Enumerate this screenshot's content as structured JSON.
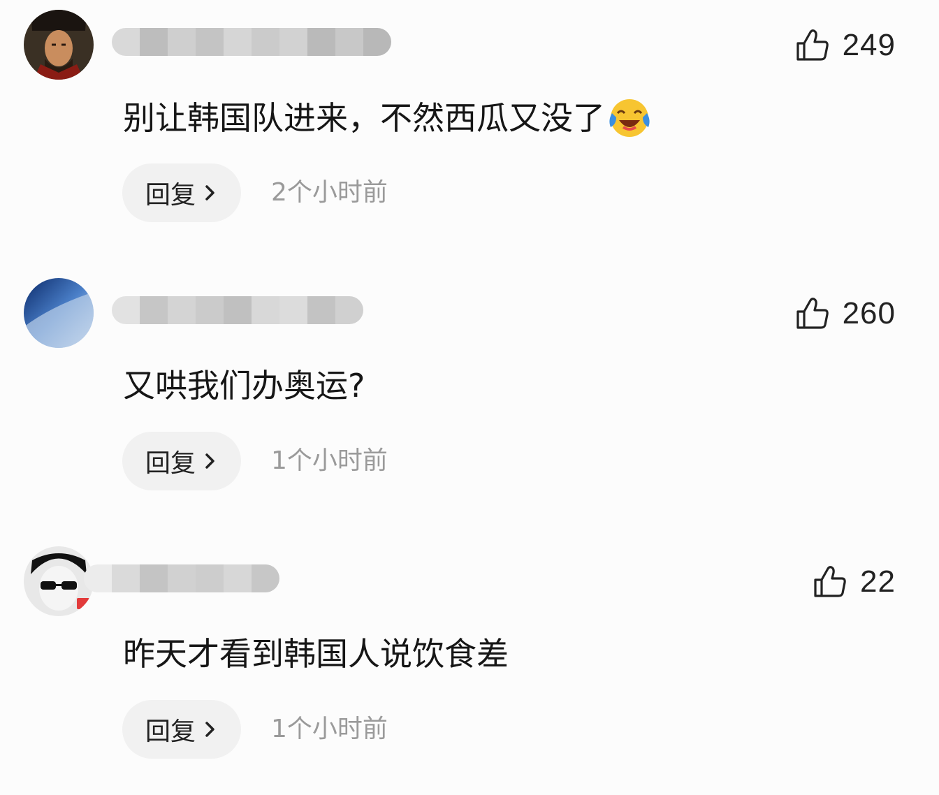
{
  "comments": [
    {
      "avatar_icon": "avatar-warrior-icon",
      "username": "",
      "likes": "249",
      "text": "别让韩国队进来，不然西瓜又没了",
      "emoji": "laughing-crying-emoji-icon",
      "reply_label": "回复",
      "time": "2个小时前"
    },
    {
      "avatar_icon": "avatar-earth-icon",
      "username": "",
      "likes": "260",
      "text": "又哄我们办奥运?",
      "reply_label": "回复",
      "time": "1个小时前"
    },
    {
      "avatar_icon": "avatar-sunglasses-icon",
      "username": "",
      "likes": "22",
      "text": "昨天才看到韩国人说饮食差",
      "reply_label": "回复",
      "time": "1个小时前"
    }
  ],
  "colors": {
    "background": "#fcfcfc",
    "reply_bg": "#f1f1f1",
    "time_text": "#9a9a9a",
    "emoji_face": "#f7c531",
    "emoji_tears": "#3b8fe0"
  }
}
